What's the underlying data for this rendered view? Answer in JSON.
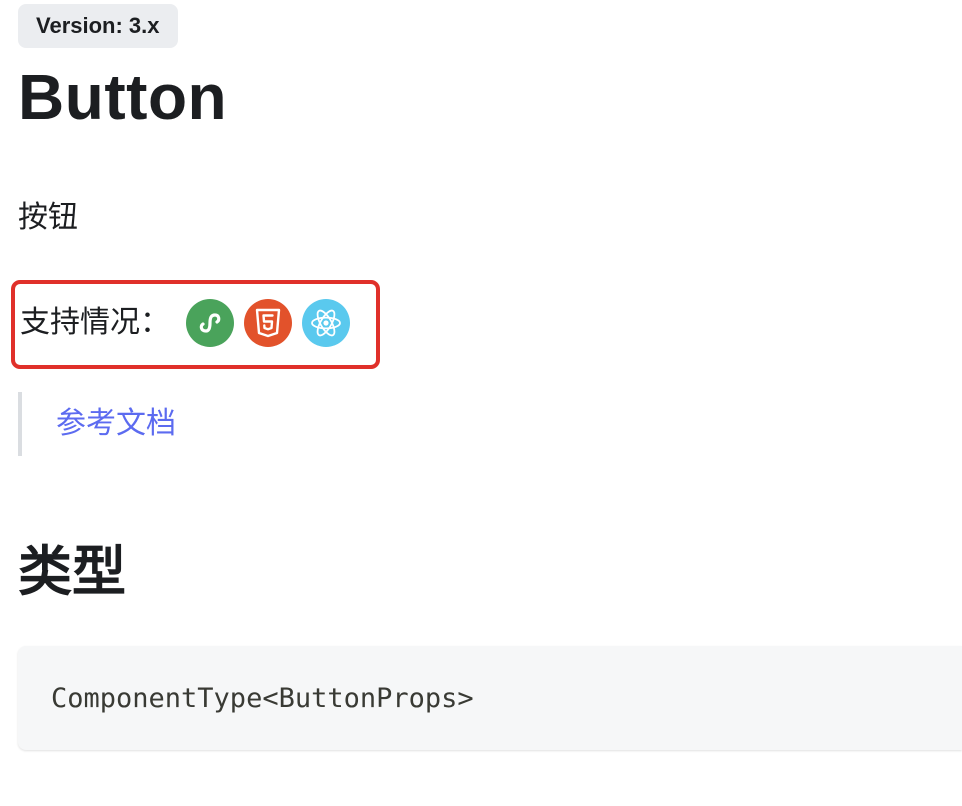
{
  "version_badge": "Version: 3.x",
  "title": "Button",
  "description": "按钮",
  "support": {
    "label": "支持情况：",
    "platforms": [
      {
        "name": "mini-program",
        "icon": "mini-program-icon",
        "color": "#4aa35b"
      },
      {
        "name": "h5",
        "icon": "html5-icon",
        "color": "#e2522b"
      },
      {
        "name": "react-native",
        "icon": "react-icon",
        "color": "#5ac9ee"
      }
    ],
    "highlight_color": "#e0302a"
  },
  "reference_link": "参考文档",
  "type_section": {
    "heading": "类型",
    "code": "ComponentType<ButtonProps>"
  },
  "colors": {
    "link": "#5c6bf0",
    "badge_bg": "#ebedf0",
    "code_bg": "#f6f7f8"
  }
}
